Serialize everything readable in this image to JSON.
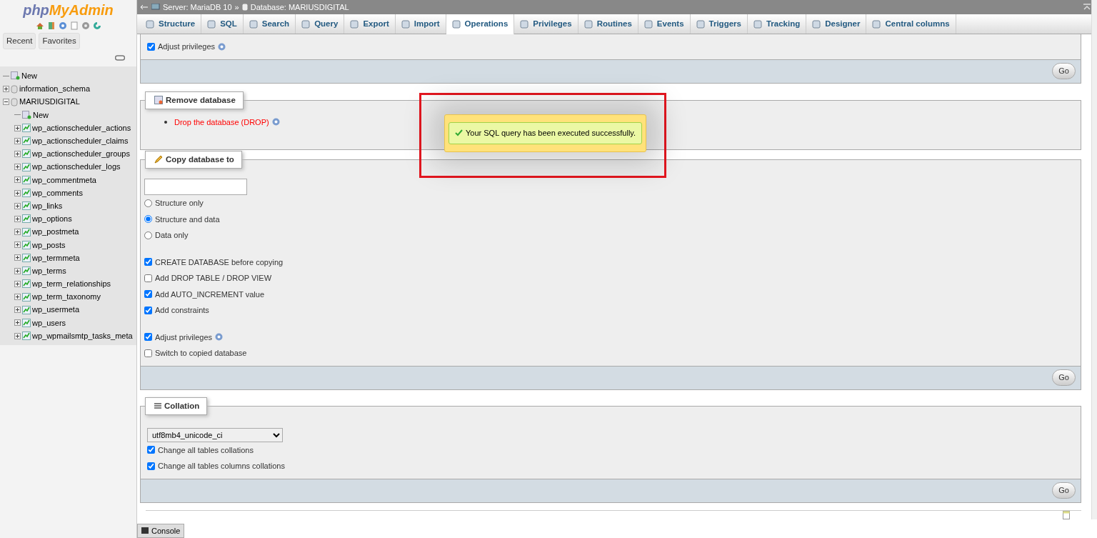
{
  "logo": {
    "part_1": "php",
    "part_2": "MyAdmin"
  },
  "nav_buttons": [
    {
      "label": "Recent"
    },
    {
      "label": "Favorites"
    }
  ],
  "tree": [
    {
      "label": "New",
      "kind": "new"
    },
    {
      "label": "information_schema",
      "kind": "db",
      "expanded": false
    },
    {
      "label": "MARIUSDIGITAL",
      "kind": "db",
      "expanded": true,
      "children": [
        {
          "label": "New",
          "kind": "new"
        },
        {
          "label": "wp_actionscheduler_actions",
          "kind": "table"
        },
        {
          "label": "wp_actionscheduler_claims",
          "kind": "table"
        },
        {
          "label": "wp_actionscheduler_groups",
          "kind": "table"
        },
        {
          "label": "wp_actionscheduler_logs",
          "kind": "table"
        },
        {
          "label": "wp_commentmeta",
          "kind": "table"
        },
        {
          "label": "wp_comments",
          "kind": "table"
        },
        {
          "label": "wp_links",
          "kind": "table"
        },
        {
          "label": "wp_options",
          "kind": "table"
        },
        {
          "label": "wp_postmeta",
          "kind": "table"
        },
        {
          "label": "wp_posts",
          "kind": "table"
        },
        {
          "label": "wp_termmeta",
          "kind": "table"
        },
        {
          "label": "wp_terms",
          "kind": "table"
        },
        {
          "label": "wp_term_relationships",
          "kind": "table"
        },
        {
          "label": "wp_term_taxonomy",
          "kind": "table"
        },
        {
          "label": "wp_usermeta",
          "kind": "table"
        },
        {
          "label": "wp_users",
          "kind": "table"
        },
        {
          "label": "wp_wpmailsmtp_tasks_meta",
          "kind": "table"
        }
      ]
    }
  ],
  "breadcrumb": {
    "items": [
      {
        "label": "Server: MariaDB 10",
        "kind": "server"
      },
      {
        "label": "Database: MARIUSDIGITAL",
        "kind": "database"
      }
    ],
    "separator": "»"
  },
  "tabs": [
    {
      "label": "Structure",
      "selected": false
    },
    {
      "label": "SQL",
      "selected": false
    },
    {
      "label": "Search",
      "selected": false
    },
    {
      "label": "Query",
      "selected": false
    },
    {
      "label": "Export",
      "selected": false
    },
    {
      "label": "Import",
      "selected": false
    },
    {
      "label": "Operations",
      "selected": true
    },
    {
      "label": "Privileges",
      "selected": false
    },
    {
      "label": "Routines",
      "selected": false
    },
    {
      "label": "Events",
      "selected": false
    },
    {
      "label": "Triggers",
      "selected": false
    },
    {
      "label": "Tracking",
      "selected": false
    },
    {
      "label": "Designer",
      "selected": false
    },
    {
      "label": "Central columns",
      "selected": false
    }
  ],
  "sections": [
    {
      "kind": "partial",
      "option_groups": [
        [
          {
            "kind": "checkbox",
            "label": "Adjust privileges",
            "checked": true,
            "help": true
          }
        ]
      ],
      "button": "Go"
    },
    {
      "kind": "remove",
      "title": "Remove database",
      "link": "Drop the database (DROP)"
    },
    {
      "kind": "copy",
      "title": "Copy database to",
      "option_groups": [
        [
          {
            "kind": "radio",
            "label": "Structure only",
            "checked": false
          },
          {
            "kind": "radio",
            "label": "Structure and data",
            "checked": true
          },
          {
            "kind": "radio",
            "label": "Data only",
            "checked": false
          }
        ],
        [
          {
            "kind": "checkbox",
            "label": "CREATE DATABASE before copying",
            "checked": true
          },
          {
            "kind": "checkbox",
            "label": "Add DROP TABLE / DROP VIEW",
            "checked": false
          },
          {
            "kind": "checkbox",
            "label": "Add AUTO_INCREMENT value",
            "checked": true
          },
          {
            "kind": "checkbox",
            "label": "Add constraints",
            "checked": true
          }
        ],
        [
          {
            "kind": "checkbox",
            "label": "Adjust privileges",
            "checked": true,
            "help": true
          },
          {
            "kind": "checkbox",
            "label": "Switch to copied database",
            "checked": false
          }
        ]
      ],
      "button": "Go"
    },
    {
      "kind": "collation",
      "title": "Collation",
      "select": "utf8mb4_unicode_ci",
      "option_groups": [
        [
          {
            "kind": "checkbox",
            "label": "Change all tables collations",
            "checked": true
          },
          {
            "kind": "checkbox",
            "label": "Change all tables columns collations",
            "checked": true
          }
        ]
      ],
      "button": "Go"
    }
  ],
  "toast": {
    "message": "Your SQL query has been executed successfully."
  },
  "console": {
    "label": "Console"
  }
}
